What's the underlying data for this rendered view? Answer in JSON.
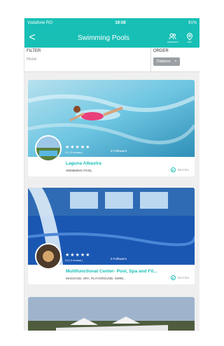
{
  "status_bar": {
    "carrier": "Vodafone RO",
    "time": "19:08",
    "battery": "91%"
  },
  "header": {
    "back_label": "<",
    "title": "Swimming Pools",
    "actions": [
      {
        "label": "FEEDBACK",
        "icon": "users-icon"
      },
      {
        "label": "MAP",
        "icon": "map-pin-icon"
      }
    ]
  },
  "filter": {
    "label": "FILTER",
    "value": "None"
  },
  "order": {
    "label": "ORDER",
    "chip": "Distance",
    "chip_close": "×"
  },
  "cards": [
    {
      "stars": "★★★★★",
      "reviews": "0.0 | 0 reviews |",
      "followers": "0 Followers",
      "name": "Laguna Albastra",
      "category": "SWIMMING POOL",
      "distance": "68.0 km"
    },
    {
      "stars": "★★★★★",
      "reviews": "0.0 | 0 reviews |",
      "followers": "0 Followers",
      "name": "Multifunctional Center- Pool, Spa and Fit...",
      "category": "MASSAGE, SPA, PLAYGROUND, SWIM...",
      "distance": "94.9 km"
    }
  ],
  "colors": {
    "accent": "#17bfb5"
  }
}
